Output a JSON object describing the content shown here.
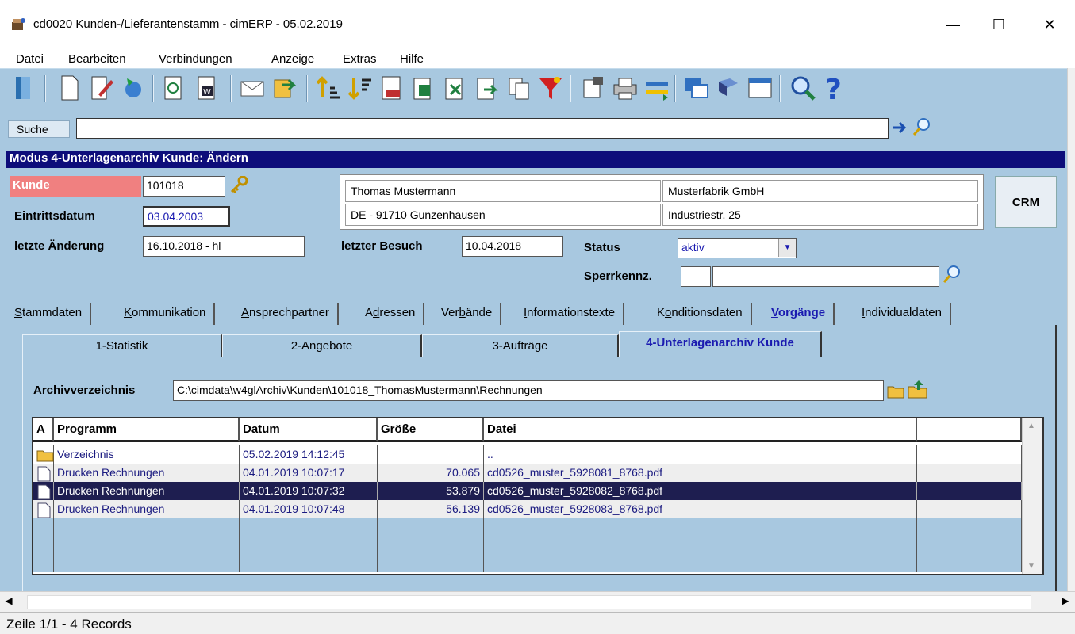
{
  "window": {
    "title": "cd0020 Kunden-/Lieferantenstamm - cimERP - 05.02.2019",
    "minimize": "—",
    "maximize": "☐",
    "close": "✕"
  },
  "menu": [
    "Datei",
    "Bearbeiten",
    "Verbindungen",
    "Anzeige",
    "Extras",
    "Hilfe"
  ],
  "search": {
    "label": "Suche",
    "value": ""
  },
  "mode": "Modus 4-Unterlagenarchiv Kunde: Ändern",
  "customer": {
    "kunde_label": "Kunde",
    "kunde_value": "101018",
    "eintritt_label": "Eintrittsdatum",
    "eintritt_value": "03.04.2003",
    "aenderung_label": "letzte Änderung",
    "aenderung_value": "16.10.2018 - hl",
    "besuch_label": "letzter Besuch",
    "besuch_value": "10.04.2018",
    "status_label": "Status",
    "status_value": "aktiv",
    "sperr_label": "Sperrkennz.",
    "sperr_code": "",
    "sperr_text": "",
    "name": "Thomas Mustermann",
    "company": "Musterfabrik GmbH",
    "city": "DE - 91710 Gunzenhausen",
    "street": "Industriestr. 25",
    "crm_label": "CRM"
  },
  "tabs": [
    {
      "pre": "",
      "u": "S",
      "post": "tammdaten"
    },
    {
      "pre": "",
      "u": "K",
      "post": "ommunikation"
    },
    {
      "pre": "",
      "u": "A",
      "post": "nsprechpartner"
    },
    {
      "pre": "A",
      "u": "d",
      "post": "ressen"
    },
    {
      "pre": "Ver",
      "u": "b",
      "post": "ände"
    },
    {
      "pre": "",
      "u": "I",
      "post": "nformationstexte"
    },
    {
      "pre": "K",
      "u": "o",
      "post": "nditionsdaten"
    },
    {
      "pre": "",
      "u": "V",
      "post": "orgänge"
    },
    {
      "pre": "",
      "u": "I",
      "post": "ndividualdaten"
    }
  ],
  "subtabs": [
    "1-Statistik",
    "2-Angebote",
    "3-Aufträge",
    "4-Unterlagenarchiv Kunde"
  ],
  "archive": {
    "label": "Archivverzeichnis",
    "path": "C:\\cimdata\\w4glArchiv\\Kunden\\101018_ThomasMustermann\\Rechnungen"
  },
  "grid": {
    "headers": [
      "A",
      "Programm",
      "Datum",
      "Größe",
      "Datei",
      ""
    ],
    "rows": [
      {
        "icon": "folder-icon",
        "programm": "Verzeichnis",
        "datum": "05.02.2019 14:12:45",
        "groesse": "",
        "datei": ".."
      },
      {
        "icon": "document-icon",
        "programm": "Drucken Rechnungen",
        "datum": "04.01.2019 10:07:17",
        "groesse": "70.065",
        "datei": "cd0526_muster_5928081_8768.pdf"
      },
      {
        "icon": "document-icon",
        "programm": "Drucken Rechnungen",
        "datum": "04.01.2019 10:07:32",
        "groesse": "53.879",
        "datei": "cd0526_muster_5928082_8768.pdf",
        "selected": true
      },
      {
        "icon": "document-icon",
        "programm": "Drucken Rechnungen",
        "datum": "04.01.2019 10:07:48",
        "groesse": "56.139",
        "datei": "cd0526_muster_5928083_8768.pdf"
      }
    ]
  },
  "status": "Zeile 1/1 - 4 Records",
  "colors": {
    "panel": "#a8c8e0",
    "modebar": "#0d0d7a",
    "kunde_label_bg": "#f08080",
    "selected_row": "#1e1e50",
    "active_tab_text": "#1a1ab0"
  }
}
